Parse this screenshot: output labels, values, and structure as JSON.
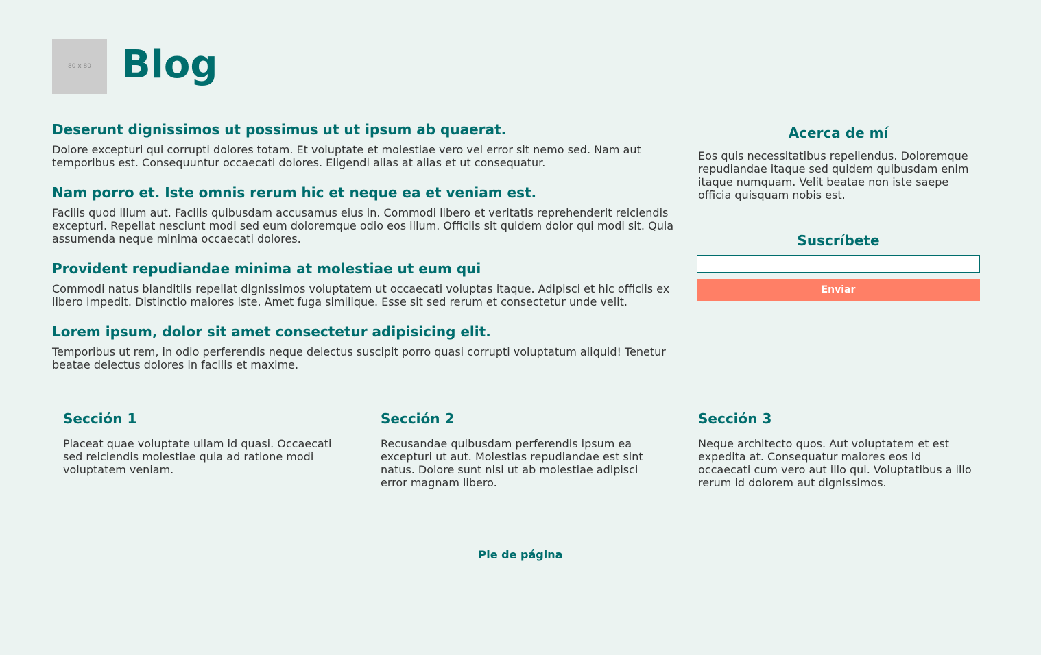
{
  "header": {
    "logo_text": "80 x 80",
    "title": "Blog"
  },
  "posts": [
    {
      "title": "Deserunt dignissimos ut possimus ut ut ipsum ab quaerat.",
      "body": "Dolore excepturi qui corrupti dolores totam. Et voluptate et molestiae vero vel error sit nemo sed. Nam aut temporibus est. Consequuntur occaecati dolores. Eligendi alias at alias et ut consequatur."
    },
    {
      "title": "Nam porro et. Iste omnis rerum hic et neque ea et veniam est.",
      "body": "Facilis quod illum aut. Facilis quibusdam accusamus eius in. Commodi libero et veritatis reprehenderit reiciendis excepturi. Repellat nesciunt modi sed eum doloremque odio eos illum. Officiis sit quidem dolor qui modi sit. Quia assumenda neque minima occaecati dolores."
    },
    {
      "title": "Provident repudiandae minima at molestiae ut eum qui",
      "body": "Commodi natus blanditiis repellat dignissimos voluptatem ut occaecati voluptas itaque. Adipisci et hic officiis ex libero impedit. Distinctio maiores iste. Amet fuga similique. Esse sit sed rerum et consectetur unde velit."
    },
    {
      "title": "Lorem ipsum, dolor sit amet consectetur adipisicing elit.",
      "body": "Temporibus ut rem, in odio perferendis neque delectus suscipit porro quasi corrupti voluptatum aliquid! Tenetur beatae delectus dolores in facilis et maxime."
    }
  ],
  "sidebar": {
    "about_title": "Acerca de mí",
    "about_text": "Eos quis necessitatibus repellendus. Doloremque repudiandae itaque sed quidem quibusdam enim itaque numquam. Velit beatae non iste saepe officia quisquam nobis est.",
    "subscribe_title": "Suscríbete",
    "email_value": "",
    "send_label": "Enviar"
  },
  "sections": [
    {
      "title": "Sección 1",
      "text": "Placeat quae voluptate ullam id quasi. Occaecati sed reiciendis molestiae quia ad ratione modi voluptatem veniam."
    },
    {
      "title": "Sección 2",
      "text": "Recusandae quibusdam perferendis ipsum ea excepturi ut aut. Molestias repudiandae est sint natus. Dolore sunt nisi ut ab molestiae adipisci error magnam libero."
    },
    {
      "title": "Sección 3",
      "text": "Neque architecto quos. Aut voluptatem et est expedita at. Consequatur maiores eos id occaecati cum vero aut illo qui. Voluptatibus a illo rerum id dolorem aut dignissimos."
    }
  ],
  "footer": {
    "text": "Pie de página"
  },
  "colors": {
    "background": "#ebf3f1",
    "accent": "#006d6d",
    "button": "#ff7f66",
    "text": "#333333"
  }
}
